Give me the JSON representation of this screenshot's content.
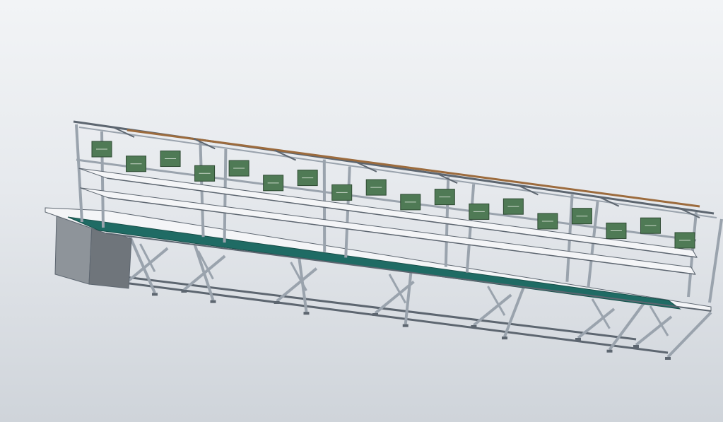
{
  "viewer": {
    "background_top": "#f2f4f6",
    "background_bottom": "#cfd4da"
  },
  "model": {
    "name": "",
    "colors": {
      "frame": "#9aa3ad",
      "frame_dark": "#5d6670",
      "work_surface": "#1f6b64",
      "shelf": "#f4f5f7",
      "cabinet": "#8e949a",
      "panel": "#4f7a55",
      "rail": "#9c6b3d"
    },
    "stations": 5,
    "lamp_panels": 18,
    "cabinets": 1
  }
}
